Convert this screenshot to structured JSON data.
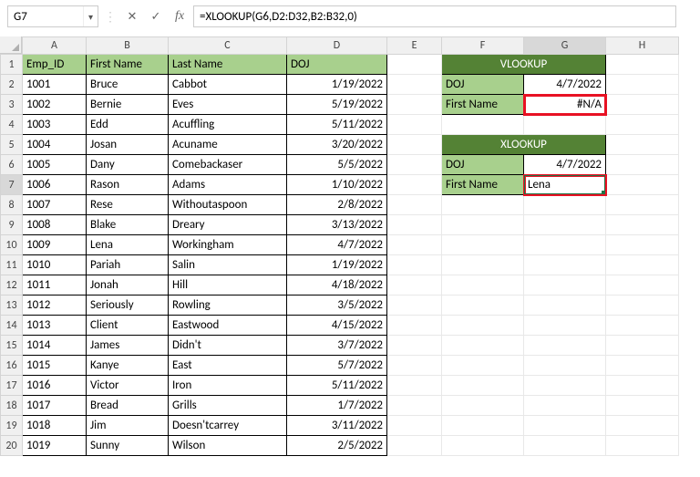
{
  "name_box": "G7",
  "formula": "=XLOOKUP(G6,D2:D32,B2:B32,0)",
  "columns": [
    "A",
    "B",
    "C",
    "D",
    "E",
    "F",
    "G",
    "H"
  ],
  "active_col": "G",
  "active_row": 7,
  "table_headers": {
    "A": "Emp_ID",
    "B": "First Name",
    "C": "Last Name",
    "D": "DOJ"
  },
  "rows": [
    {
      "n": 1
    },
    {
      "n": 2,
      "A": "1001",
      "B": "Bruce",
      "C": "Cabbot",
      "D": "1/19/2022"
    },
    {
      "n": 3,
      "A": "1002",
      "B": "Bernie",
      "C": "Eves",
      "D": "5/19/2022"
    },
    {
      "n": 4,
      "A": "1003",
      "B": "Edd",
      "C": "Acuffling",
      "D": "5/11/2022"
    },
    {
      "n": 5,
      "A": "1004",
      "B": "Josan",
      "C": "Acuname",
      "D": "3/20/2022"
    },
    {
      "n": 6,
      "A": "1005",
      "B": "Dany",
      "C": "Comebackaser",
      "D": "5/5/2022"
    },
    {
      "n": 7,
      "A": "1006",
      "B": "Rason",
      "C": "Adams",
      "D": "1/10/2022"
    },
    {
      "n": 8,
      "A": "1007",
      "B": "Rese",
      "C": "Withoutaspoon",
      "D": "2/8/2022"
    },
    {
      "n": 9,
      "A": "1008",
      "B": "Blake",
      "C": "Dreary",
      "D": "3/13/2022"
    },
    {
      "n": 10,
      "A": "1009",
      "B": "Lena",
      "C": "Workingham",
      "D": "4/7/2022"
    },
    {
      "n": 11,
      "A": "1010",
      "B": "Pariah",
      "C": "Salin",
      "D": "1/19/2022"
    },
    {
      "n": 12,
      "A": "1011",
      "B": "Jonah",
      "C": "Hill",
      "D": "4/18/2022"
    },
    {
      "n": 13,
      "A": "1012",
      "B": "Seriously",
      "C": "Rowling",
      "D": "3/5/2022"
    },
    {
      "n": 14,
      "A": "1013",
      "B": "Client",
      "C": "Eastwood",
      "D": "4/15/2022"
    },
    {
      "n": 15,
      "A": "1014",
      "B": "James",
      "C": "Didn't",
      "D": "3/7/2022"
    },
    {
      "n": 16,
      "A": "1015",
      "B": "Kanye",
      "C": "East",
      "D": "5/7/2022"
    },
    {
      "n": 17,
      "A": "1016",
      "B": "Victor",
      "C": "Iron",
      "D": "5/11/2022"
    },
    {
      "n": 18,
      "A": "1017",
      "B": "Bread",
      "C": "Grills",
      "D": "1/7/2022"
    },
    {
      "n": 19,
      "A": "1018",
      "B": "Jim",
      "C": "Doesn'tcarrey",
      "D": "3/11/2022"
    },
    {
      "n": 20,
      "A": "1019",
      "B": "Sunny",
      "C": "Wilson",
      "D": "2/5/2022"
    }
  ],
  "vlookup": {
    "title": "VLOOKUP",
    "doj_label": "DOJ",
    "doj_value": "4/7/2022",
    "fn_label": "First Name",
    "fn_value": "#N/A"
  },
  "xlookup": {
    "title": "XLOOKUP",
    "doj_label": "DOJ",
    "doj_value": "4/7/2022",
    "fn_label": "First Name",
    "fn_value": "Lena"
  },
  "icons": {
    "cancel": "✕",
    "confirm": "✓",
    "fx": "fx",
    "chevron": "▾"
  }
}
